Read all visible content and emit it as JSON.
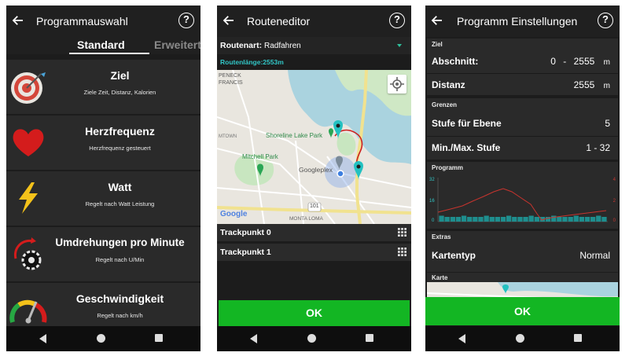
{
  "screen1": {
    "title": "Programmauswahl",
    "tabs": [
      "Standard",
      "Erweitert"
    ],
    "items": [
      {
        "title": "Ziel",
        "subtitle": "Ziele Zeit, Distanz, Kalorien",
        "icon": "target-icon"
      },
      {
        "title": "Herzfrequenz",
        "subtitle": "Herzfrequenz gesteuert",
        "icon": "heart-icon"
      },
      {
        "title": "Watt",
        "subtitle": "Regelt nach Watt Leistung",
        "icon": "lightning-icon"
      },
      {
        "title": "Umdrehungen pro Minute",
        "subtitle": "Regelt nach U/Min",
        "icon": "cadence-gear-icon"
      },
      {
        "title": "Geschwindigkeit",
        "subtitle": "Regelt nach km/h",
        "icon": "speedometer-icon"
      }
    ]
  },
  "screen2": {
    "title": "Routeneditor",
    "route_type_label": "Routenart:",
    "route_type_value": "Radfahren",
    "route_length": "Routenlänge:2553m",
    "map_labels": {
      "peneck": "PENECK",
      "francis": "FRANCIS",
      "shoreline": "Shoreline Lake Park",
      "mitchell": "Mitchell Park",
      "googleplex": "Googleplex",
      "montaloma": "MONTA LOMA",
      "motown": "MTOWN",
      "hwy": "101",
      "google": "Google"
    },
    "trackpoints": [
      "Trackpunkt 0",
      "Trackpunkt 1"
    ],
    "ok_label": "OK"
  },
  "screen3": {
    "title": "Programm Einstellungen",
    "sections": {
      "ziel": "Ziel",
      "grenzen": "Grenzen",
      "programm": "Programm",
      "extras": "Extras",
      "karte": "Karte"
    },
    "abschnitt": {
      "label": "Abschnitt:",
      "from": "0",
      "dash": "-",
      "to": "2555",
      "unit": "m"
    },
    "distanz": {
      "label": "Distanz",
      "value": "2555",
      "unit": "m"
    },
    "stufe_ebene": {
      "label": "Stufe für Ebene",
      "value": "5"
    },
    "minmax_stufe": {
      "label": "Min./Max. Stufe",
      "value": "1 - 32"
    },
    "kartentyp": {
      "label": "Kartentyp",
      "value": "Normal"
    },
    "chart_ticks_left": [
      "32",
      "16",
      "0"
    ],
    "chart_ticks_right": [
      "4",
      "2",
      "0"
    ],
    "ok_label": "OK"
  },
  "colors": {
    "ok_green": "#13b623",
    "teal": "#32c7c7",
    "bars": "#1e8e8e",
    "line_red": "#c8342e",
    "background": "#1c1c1c"
  }
}
